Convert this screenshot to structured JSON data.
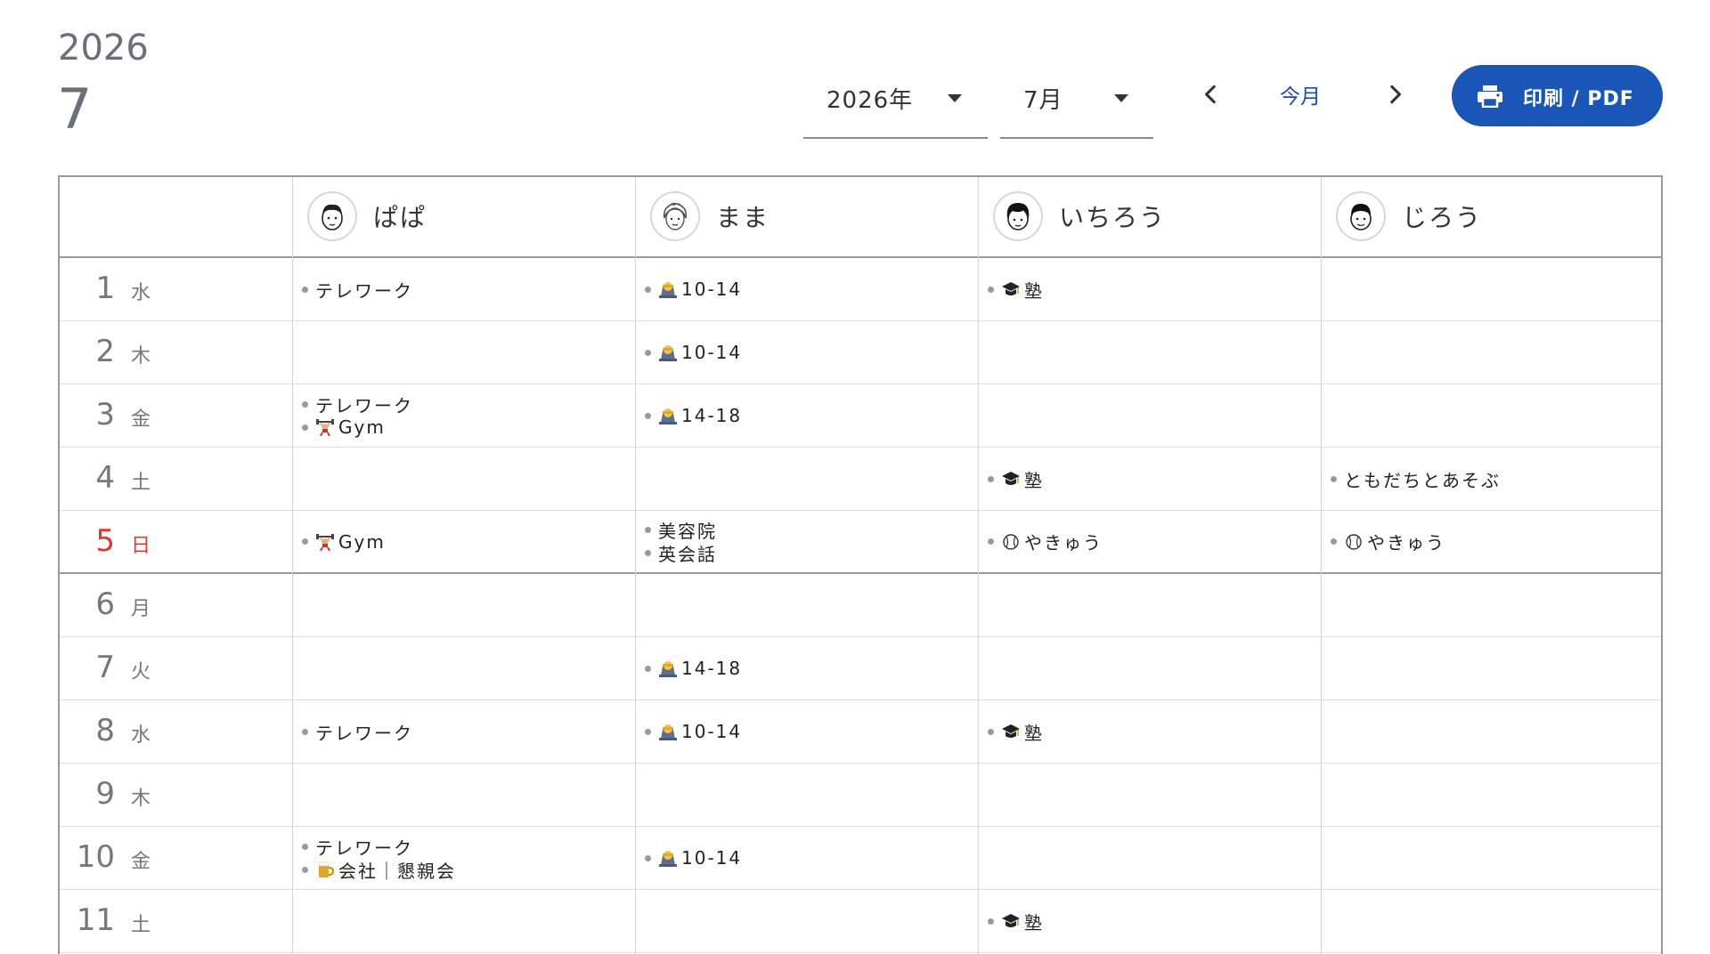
{
  "header": {
    "year": "2026",
    "month": "7",
    "year_select": "2026年",
    "month_select": "7月",
    "today_label": "今月",
    "print_label": "印刷 / PDF"
  },
  "colors": {
    "accent": "#1a56b8",
    "sunday": "#d93b30",
    "text_muted": "#777777"
  },
  "people": [
    {
      "name": "ぱぱ",
      "icon": "papa-avatar-icon"
    },
    {
      "name": "まま",
      "icon": "mama-avatar-icon"
    },
    {
      "name": "いちろう",
      "icon": "ichiro-avatar-icon"
    },
    {
      "name": "じろう",
      "icon": "jiro-avatar-icon"
    }
  ],
  "days": [
    {
      "day": "1",
      "weekday": "水",
      "events": [
        [
          {
            "icon": "",
            "text": "テレワーク"
          }
        ],
        [
          {
            "icon": "work-icon",
            "text": "10-14"
          }
        ],
        [
          {
            "icon": "graduation-cap-icon",
            "text": "塾"
          }
        ],
        []
      ]
    },
    {
      "day": "2",
      "weekday": "木",
      "events": [
        [],
        [
          {
            "icon": "work-icon",
            "text": "10-14"
          }
        ],
        [],
        []
      ]
    },
    {
      "day": "3",
      "weekday": "金",
      "events": [
        [
          {
            "icon": "",
            "text": "テレワーク"
          },
          {
            "icon": "weightlifter-icon",
            "text": "Gym"
          }
        ],
        [
          {
            "icon": "work-icon",
            "text": "14-18"
          }
        ],
        [],
        []
      ]
    },
    {
      "day": "4",
      "weekday": "土",
      "events": [
        [],
        [],
        [
          {
            "icon": "graduation-cap-icon",
            "text": "塾"
          }
        ],
        [
          {
            "icon": "",
            "text": "ともだちとあそぶ"
          }
        ]
      ]
    },
    {
      "day": "5",
      "weekday": "日",
      "sunday": true,
      "events": [
        [
          {
            "icon": "weightlifter-icon",
            "text": "Gym"
          }
        ],
        [
          {
            "icon": "",
            "text": "美容院"
          },
          {
            "icon": "",
            "text": "英会話"
          }
        ],
        [
          {
            "icon": "baseball-icon",
            "text": "やきゅう"
          }
        ],
        [
          {
            "icon": "baseball-icon",
            "text": "やきゅう"
          }
        ]
      ]
    },
    {
      "day": "6",
      "weekday": "月",
      "events": [
        [],
        [],
        [],
        []
      ]
    },
    {
      "day": "7",
      "weekday": "火",
      "events": [
        [],
        [
          {
            "icon": "work-icon",
            "text": "14-18"
          }
        ],
        [],
        []
      ]
    },
    {
      "day": "8",
      "weekday": "水",
      "events": [
        [
          {
            "icon": "",
            "text": "テレワーク"
          }
        ],
        [
          {
            "icon": "work-icon",
            "text": "10-14"
          }
        ],
        [
          {
            "icon": "graduation-cap-icon",
            "text": "塾"
          }
        ],
        []
      ]
    },
    {
      "day": "9",
      "weekday": "木",
      "events": [
        [],
        [],
        [],
        []
      ]
    },
    {
      "day": "10",
      "weekday": "金",
      "events": [
        [
          {
            "icon": "",
            "text": "テレワーク"
          },
          {
            "icon": "beer-icon",
            "text": "会社｜懇親会"
          }
        ],
        [
          {
            "icon": "work-icon",
            "text": "10-14"
          }
        ],
        [],
        []
      ]
    },
    {
      "day": "11",
      "weekday": "土",
      "events": [
        [],
        [],
        [
          {
            "icon": "graduation-cap-icon",
            "text": "塾"
          }
        ],
        []
      ]
    }
  ]
}
